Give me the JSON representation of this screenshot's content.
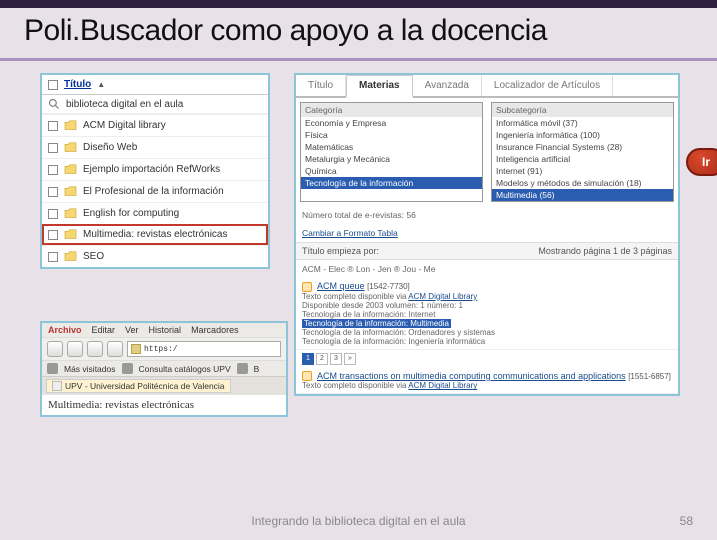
{
  "slide": {
    "title": "Poli.Buscador como apoyo a la docencia",
    "footer_left": "Integrando la biblioteca digital en el aula",
    "footer_right": "58"
  },
  "left_panel": {
    "header": "Título",
    "search_text": "biblioteca digital en el aula",
    "folders": [
      "ACM Digital library",
      "Diseño Web",
      "Ejemplo importación RefWorks",
      "El Profesional de la información",
      "English for computing",
      "Multimedia: revistas electrónicas",
      "SEO"
    ],
    "highlight_index": 5
  },
  "browser": {
    "menu": [
      "Archivo",
      "Editar",
      "Ver",
      "Historial",
      "Marcadores"
    ],
    "url": "https:/",
    "bookmarks": [
      "Más visitados",
      "Consulta catálogos UPV",
      "B"
    ],
    "tab_label": "UPV - Universidad Politécnica de Valencia",
    "page_title": "Multimedia: revistas electrónicas"
  },
  "right_panel": {
    "tabs": [
      "Título",
      "Materias",
      "Avanzada",
      "Localizador de Artículos"
    ],
    "active_tab": 1,
    "cat_header": "Categoría",
    "categories": [
      "Economía y Empresa",
      "Física",
      "Matemáticas",
      "Metalurgia y Mecánica",
      "Química",
      "Tecnología de la información"
    ],
    "cat_selected": 5,
    "subcat_header": "Subcategoría",
    "subcategories": [
      "Informática móvil (37)",
      "Ingeniería informática (100)",
      "Insurance Financial Systems (28)",
      "Inteligencia artificial",
      "Internet (91)",
      "Modelos y métodos de simulación (18)",
      "Multimedia (56)"
    ],
    "subcat_selected": 6,
    "ir_label": "Ir",
    "total_line": "Número total de e-revistas: 56",
    "change_link": "Cambiar a Formato Tabla",
    "listing_left": "Título empieza por:",
    "listing_nav": "ACM - Elec ® Lon - Jen ® Jou - Me",
    "listing_right": "Mostrando página 1 de 3 páginas",
    "entry1": {
      "title": "ACM queue",
      "issn": "[1542-7730]",
      "avail": "Texto completo disponible via ACM Digital Library",
      "since": "Disponible desde 2003 volumen: 1 número: 1",
      "tags": [
        "Tecnología de la información: Internet",
        "Tecnología de la información: Multimedia",
        "Tecnología de la información: Ordenadores y sistemas",
        "Tecnología de la información: Ingeniería informática"
      ],
      "tag_selected": 1
    },
    "entry2": {
      "title": "ACM transactions on multimedia computing communications and applications",
      "issn": "[1551-6857]",
      "avail": "Texto completo disponible via ACM Digital Library"
    }
  }
}
